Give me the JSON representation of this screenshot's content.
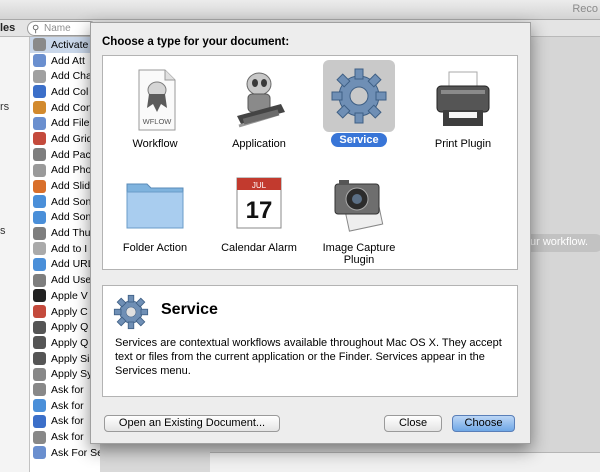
{
  "window": {
    "title": "Reco"
  },
  "library": {
    "header_fragment": "les",
    "search_placeholder": "Name",
    "cut_labels": [
      {
        "text": "rs"
      },
      {
        "text": "s"
      }
    ]
  },
  "actions": [
    {
      "label": "Activate",
      "color": "#8a8a8a",
      "selected": true
    },
    {
      "label": "Add Att",
      "color": "#6a8fcf"
    },
    {
      "label": "Add Cha",
      "color": "#a0a0a0"
    },
    {
      "label": "Add Col",
      "color": "#3b6fc9"
    },
    {
      "label": "Add Con",
      "color": "#d28a2e"
    },
    {
      "label": "Add File",
      "color": "#6a8fcf"
    },
    {
      "label": "Add Grid",
      "color": "#c44a3c"
    },
    {
      "label": "Add Pac",
      "color": "#7e7e7e"
    },
    {
      "label": "Add Pho",
      "color": "#9a9a9a"
    },
    {
      "label": "Add Slid",
      "color": "#d96f2a"
    },
    {
      "label": "Add Son",
      "color": "#4a8fd9"
    },
    {
      "label": "Add Son",
      "color": "#4a8fd9"
    },
    {
      "label": "Add Thu",
      "color": "#7e7e7e"
    },
    {
      "label": "Add to I",
      "color": "#aaaaaa"
    },
    {
      "label": "Add URL",
      "color": "#4a8fd9"
    },
    {
      "label": "Add Use",
      "color": "#7e7e7e"
    },
    {
      "label": "Apple V",
      "color": "#222222"
    },
    {
      "label": "Apply C",
      "color": "#c44a3c"
    },
    {
      "label": "Apply Q",
      "color": "#555555"
    },
    {
      "label": "Apply Q",
      "color": "#555555"
    },
    {
      "label": "Apply Si",
      "color": "#555555"
    },
    {
      "label": "Apply Sy",
      "color": "#888888"
    },
    {
      "label": "Ask for",
      "color": "#888888"
    },
    {
      "label": "Ask for",
      "color": "#4a8fd9"
    },
    {
      "label": "Ask for",
      "color": "#3b6fc9"
    },
    {
      "label": "Ask for",
      "color": "#888888"
    },
    {
      "label": "Ask For Servers",
      "color": "#6a8fcf"
    }
  ],
  "workflow_hint": "ur workflow.",
  "sheet": {
    "title": "Choose a type for your document:",
    "types": [
      {
        "label": "Workflow",
        "icon": "workflow-document-icon"
      },
      {
        "label": "Application",
        "icon": "automator-robot-icon"
      },
      {
        "label": "Service",
        "icon": "gear-icon",
        "selected": true
      },
      {
        "label": "Print Plugin",
        "icon": "printer-icon"
      },
      {
        "label": "Folder Action",
        "icon": "folder-icon"
      },
      {
        "label": "Calendar Alarm",
        "icon": "calendar-icon"
      },
      {
        "label": "Image Capture Plugin",
        "icon": "camera-icon"
      }
    ],
    "workflow_doc_label": "WFLOW",
    "calendar_month": "JUL",
    "calendar_day": "17",
    "description": {
      "title": "Service",
      "text": "Services are contextual workflows available throughout Mac OS X. They accept text or files from the current application or the Finder. Services appear in the Services menu."
    },
    "buttons": {
      "open_existing": "Open an Existing Document...",
      "close": "Close",
      "choose": "Choose"
    }
  }
}
